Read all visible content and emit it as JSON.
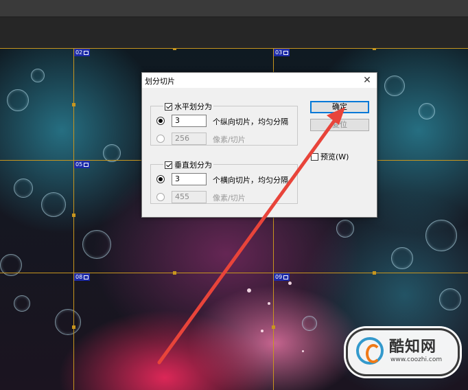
{
  "dialog": {
    "title": "划分切片",
    "close_glyph": "✕",
    "horizontal": {
      "checkbox_label": "水平划分为",
      "checked": true,
      "count_value": "3",
      "count_label": "个纵向切片，均匀分隔",
      "pixels_value": "256",
      "pixels_label": "像素/切片"
    },
    "vertical": {
      "checkbox_label": "垂直划分为",
      "checked": true,
      "count_value": "3",
      "count_label": "个横向切片，均匀分隔",
      "pixels_value": "455",
      "pixels_label": "像素/切片"
    },
    "ok_label": "确定",
    "reset_label": "复位",
    "preview_label": "预览(W)"
  },
  "slices": {
    "labels": [
      "02",
      "03",
      "05",
      "08",
      "09"
    ]
  },
  "watermark": {
    "name": "酷知网",
    "url": "www.coozhi.com"
  },
  "colors": {
    "guide": "#c8961e",
    "slice_label_bg": "#1c2aa8",
    "arrow": "#e8443a",
    "primary_button_border": "#0078d7"
  }
}
